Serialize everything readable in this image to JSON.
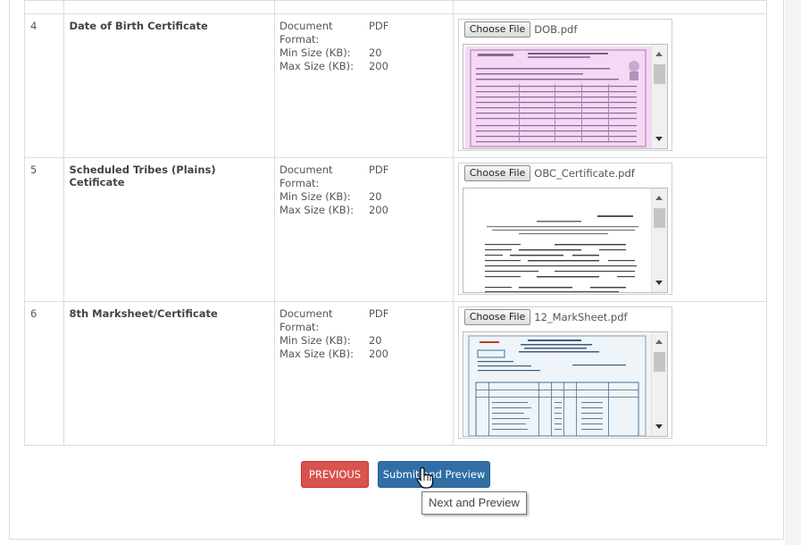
{
  "documents": [
    {
      "sn": "4",
      "name": "Date of Birth Certificate",
      "format_label": "Document Format:",
      "format_value": "PDF",
      "min_label": "Min Size (KB):",
      "min_value": "20",
      "max_label": "Max Size (KB):",
      "max_value": "200",
      "choose_label": "Choose File",
      "file_name": "DOB.pdf",
      "preview_tint": "#f4d8f4"
    },
    {
      "sn": "5",
      "name": "Scheduled Tribes (Plains) Cetificate",
      "format_label": "Document Format:",
      "format_value": "PDF",
      "min_label": "Min Size (KB):",
      "min_value": "20",
      "max_label": "Max Size (KB):",
      "max_value": "200",
      "choose_label": "Choose File",
      "file_name": "OBC_Certificate.pdf",
      "preview_tint": "#ffffff"
    },
    {
      "sn": "6",
      "name": "8th Marksheet/Certificate",
      "format_label": "Document Format:",
      "format_value": "PDF",
      "min_label": "Min Size (KB):",
      "min_value": "20",
      "max_label": "Max Size (KB):",
      "max_value": "200",
      "choose_label": "Choose File",
      "file_name": "12_MarkSheet.pdf",
      "preview_tint": "#eef4f8"
    }
  ],
  "actions": {
    "previous_label": "PREVIOUS",
    "submit_label": "Submit and Preview"
  },
  "tooltip": {
    "text": "Next and Preview"
  },
  "colors": {
    "previous_bg": "#d9534f",
    "submit_bg": "#2f6fa6"
  },
  "icons": {
    "cursor": "hand-pointer-icon"
  }
}
